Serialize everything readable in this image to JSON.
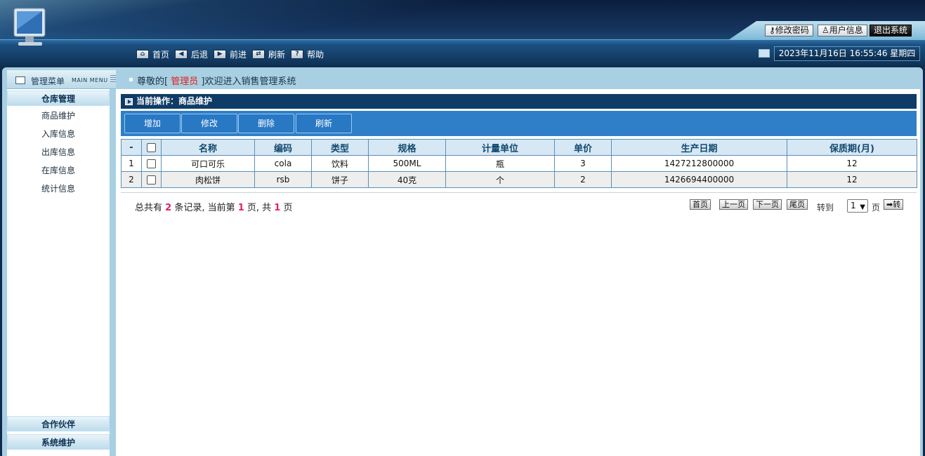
{
  "header": {
    "top_buttons": {
      "change_password": "修改密码",
      "user_info": "用户信息",
      "logout": "退出系统"
    },
    "nav": [
      {
        "label": "首页",
        "icon": "home-icon"
      },
      {
        "label": "后退",
        "icon": "arrow-left-icon"
      },
      {
        "label": "前进",
        "icon": "arrow-right-icon"
      },
      {
        "label": "刷新",
        "icon": "refresh-icon"
      },
      {
        "label": "帮助",
        "icon": "help-icon"
      }
    ],
    "datetime": "2023年11月16日 16:55:46 星期四"
  },
  "sidebar": {
    "title": "管理菜单",
    "subtitle": "MAIN MENU",
    "categories": [
      {
        "label": "仓库管理",
        "items": [
          "商品维护",
          "入库信息",
          "出库信息",
          "在库信息",
          "统计信息"
        ]
      },
      {
        "label": "合作伙伴"
      },
      {
        "label": "系统维护"
      }
    ]
  },
  "welcome": {
    "prefix": "尊敬的[ ",
    "role": "管理员",
    "suffix": " ]欢迎进入销售管理系统"
  },
  "operation": "当前操作：商品维护",
  "toolbar": {
    "add": "增加",
    "edit": "修改",
    "delete": "删除",
    "refresh": "刷新"
  },
  "table": {
    "columns": [
      "-",
      "",
      "名称",
      "编码",
      "类型",
      "规格",
      "计量单位",
      "单价",
      "生产日期",
      "保质期(月)"
    ],
    "rows": [
      {
        "index": "1",
        "name": "可口可乐",
        "code": "cola",
        "type": "饮料",
        "spec": "500ML",
        "unit": "瓶",
        "price": "3",
        "date": "1427212800000",
        "shelf": "12"
      },
      {
        "index": "2",
        "name": "肉松饼",
        "code": "rsb",
        "type": "饼子",
        "spec": "40克",
        "unit": "个",
        "price": "2",
        "date": "1426694400000",
        "shelf": "12"
      }
    ]
  },
  "pager": {
    "t1": "总共有 ",
    "total_records": "2",
    "t2": " 条记录, 当前第 ",
    "current_page": "1",
    "t3": " 页, 共 ",
    "total_pages": "1",
    "t4": " 页",
    "first": "首页",
    "prev": "上一页",
    "next": "下一页",
    "last": "尾页",
    "goto": "转到",
    "selected_page": "1",
    "page_unit": "页",
    "go": "➡转"
  }
}
